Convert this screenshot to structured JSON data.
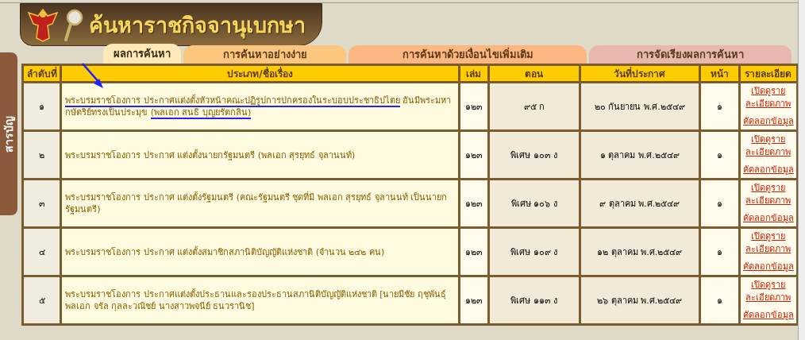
{
  "header": {
    "title": "ค้นหาราชกิจจานุเบกษา"
  },
  "side_tab": {
    "label": "สารบัญ"
  },
  "tabs": [
    {
      "label": "ผลการค้นหา",
      "selected": true,
      "color": "#fde9b8"
    },
    {
      "label": "การค้นหาอย่างง่าย",
      "selected": false,
      "color": "#fcc67e"
    },
    {
      "label": "การค้นหาด้วยเงื่อนไขเพิ่มเติม",
      "selected": false,
      "color": "#fbb681"
    },
    {
      "label": "การจัดเรียงผลการค้นหา",
      "selected": false,
      "color": "#e8b7b0"
    }
  ],
  "table": {
    "columns": [
      "ลำดับที่",
      "ประเภท/ชื่อเรื่อง",
      "เล่ม",
      "ตอน",
      "วันที่ประกาศ",
      "หน้า",
      "รายละเอียด"
    ],
    "rows": [
      {
        "no": "๑",
        "title": [
          {
            "text": "พระบรมราชโองการ ประกาศแต่งตั้งหัวหน้าคณะปฏิรูปการปกครองในระบอบประชาธิปไตย",
            "marked": true
          },
          {
            "text": " อันมีพระมหากษัตริย์ทรงเป็นประมุข ",
            "marked": false
          },
          {
            "text": "(พลเอก สนธิ บุญยรัตกลิน)",
            "marked": true
          }
        ],
        "volume": "๑๒๓",
        "issue": "๙๕ ก",
        "date": "๒๐ กันยายน พ.ศ.๒๕๔๙",
        "page": "๑",
        "view_link": "เปิดดูรายละเอียดภาพ",
        "copy_link": "คัดลอกข้อมูล"
      },
      {
        "no": "๒",
        "title": [
          {
            "text": "พระบรมราชโองการ ประกาศ แต่งตั้งนายกรัฐมนตรี (พลเอก สุรยุทธ์ จุลานนท์)",
            "marked": false
          }
        ],
        "volume": "๑๒๓",
        "issue": "พิเศษ ๑๐๓ ง",
        "date": "๑ ตุลาคม พ.ศ.๒๕๔๙",
        "page": "๑",
        "view_link": "เปิดดูรายละเอียดภาพ",
        "copy_link": "คัดลอกข้อมูล"
      },
      {
        "no": "๓",
        "title": [
          {
            "text": "พระบรมราชโองการ ประกาศ แต่งตั้งรัฐมนตรี (คณะรัฐมนตรี ชุดที่มี พลเอก สุรยุทธ์ จุลานนท์ เป็นนายกรัฐมนตรี)",
            "marked": false
          }
        ],
        "volume": "๑๒๓",
        "issue": "พิเศษ ๑๐๖ ง",
        "date": "๙ ตุลาคม พ.ศ.๒๕๔๙",
        "page": "๑",
        "view_link": "เปิดดูรายละเอียดภาพ",
        "copy_link": "คัดลอกข้อมูล"
      },
      {
        "no": "๔",
        "title": [
          {
            "text": "พระบรมราชโองการ ประกาศ แต่งตั้งสมาชิกสภานิติบัญญัติแห่งชาติ (จำนวน ๒๔๒ คน)",
            "marked": false
          }
        ],
        "volume": "๑๒๓",
        "issue": "พิเศษ ๑๐๙ ง",
        "date": "๑๒ ตุลาคม พ.ศ.๒๕๔๙",
        "page": "๑",
        "view_link": "เปิดดูรายละเอียดภาพ",
        "copy_link": "คัดลอกข้อมูล"
      },
      {
        "no": "๕",
        "title": [
          {
            "text": "พระบรมราชโองการ ประกาศแต่งตั้งประธานและรองประธานสภานิติบัญญัติแห่งชาติ [นายมีชัย ฤชุพันธุ์ พลเอก จรัล กุลละวณิชย์ นางสาวพจนีย์ ธนวรานิช]",
            "marked": false
          }
        ],
        "volume": "๑๒๓",
        "issue": "พิเศษ ๑๑๓ ง",
        "date": "๒๖ ตุลาคม พ.ศ.๒๕๔๙",
        "page": "๑",
        "view_link": "เปิดดูรายละเอียดภาพ",
        "copy_link": "คัดลอกข้อมูล"
      }
    ]
  }
}
